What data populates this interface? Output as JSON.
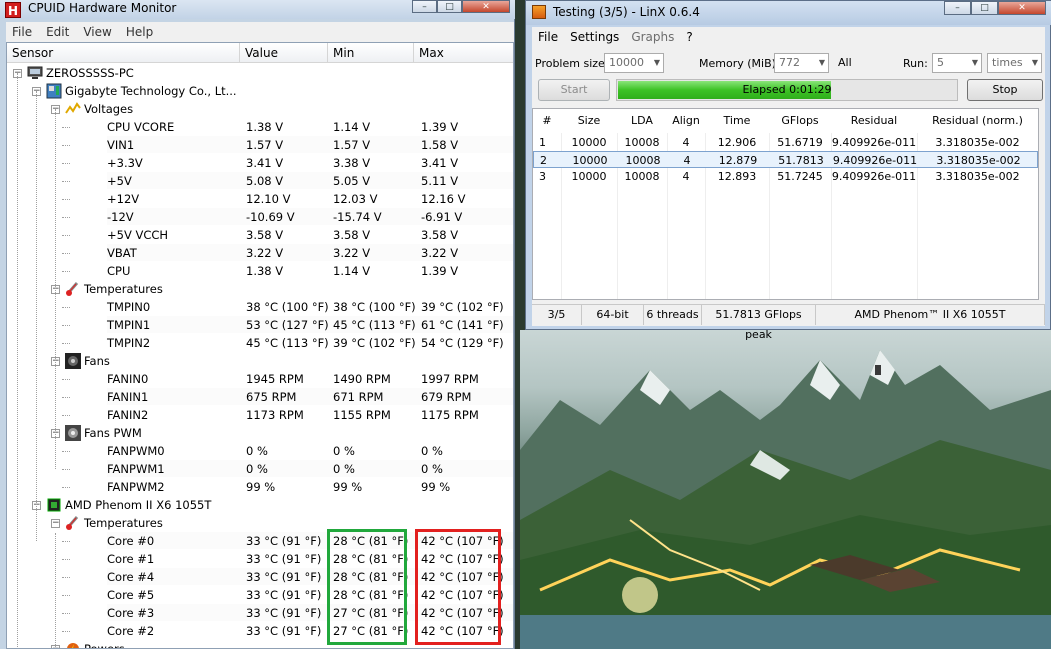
{
  "hwmonitor": {
    "title": "CPUID Hardware Monitor",
    "icon_letter": "H",
    "menu": [
      "File",
      "Edit",
      "View",
      "Help"
    ],
    "columns": [
      "Sensor",
      "Value",
      "Min",
      "Max"
    ],
    "rows": [
      {
        "level": 0,
        "kind": "node",
        "icon": "computer-icon",
        "label": "ZEROSSSSS-PC"
      },
      {
        "level": 1,
        "kind": "node",
        "icon": "motherboard-icon",
        "label": "Gigabyte Technology Co., Lt..."
      },
      {
        "level": 2,
        "kind": "node",
        "icon": "voltage-icon",
        "label": "Voltages"
      },
      {
        "level": 3,
        "kind": "leaf",
        "label": "CPU VCORE",
        "value": "1.38 V",
        "min": "1.14 V",
        "max": "1.39 V"
      },
      {
        "level": 3,
        "kind": "leaf",
        "label": "VIN1",
        "value": "1.57 V",
        "min": "1.57 V",
        "max": "1.58 V"
      },
      {
        "level": 3,
        "kind": "leaf",
        "label": "+3.3V",
        "value": "3.41 V",
        "min": "3.38 V",
        "max": "3.41 V"
      },
      {
        "level": 3,
        "kind": "leaf",
        "label": "+5V",
        "value": "5.08 V",
        "min": "5.05 V",
        "max": "5.11 V"
      },
      {
        "level": 3,
        "kind": "leaf",
        "label": "+12V",
        "value": "12.10 V",
        "min": "12.03 V",
        "max": "12.16 V"
      },
      {
        "level": 3,
        "kind": "leaf",
        "label": "-12V",
        "value": "-10.69 V",
        "min": "-15.74 V",
        "max": "-6.91 V"
      },
      {
        "level": 3,
        "kind": "leaf",
        "label": "+5V VCCH",
        "value": "3.58 V",
        "min": "3.58 V",
        "max": "3.58 V"
      },
      {
        "level": 3,
        "kind": "leaf",
        "label": "VBAT",
        "value": "3.22 V",
        "min": "3.22 V",
        "max": "3.22 V"
      },
      {
        "level": 3,
        "kind": "leaf",
        "label": "CPU",
        "value": "1.38 V",
        "min": "1.14 V",
        "max": "1.39 V"
      },
      {
        "level": 2,
        "kind": "node",
        "icon": "thermometer-icon",
        "label": "Temperatures"
      },
      {
        "level": 3,
        "kind": "leaf",
        "label": "TMPIN0",
        "value": "38 °C  (100 °F)",
        "min": "38 °C  (100 °F)",
        "max": "39 °C  (102 °F)"
      },
      {
        "level": 3,
        "kind": "leaf",
        "label": "TMPIN1",
        "value": "53 °C  (127 °F)",
        "min": "45 °C  (113 °F)",
        "max": "61 °C  (141 °F)"
      },
      {
        "level": 3,
        "kind": "leaf",
        "label": "TMPIN2",
        "value": "45 °C  (113 °F)",
        "min": "39 °C  (102 °F)",
        "max": "54 °C  (129 °F)"
      },
      {
        "level": 2,
        "kind": "node",
        "icon": "fan-icon",
        "label": "Fans"
      },
      {
        "level": 3,
        "kind": "leaf",
        "label": "FANIN0",
        "value": "1945 RPM",
        "min": "1490 RPM",
        "max": "1997 RPM"
      },
      {
        "level": 3,
        "kind": "leaf",
        "label": "FANIN1",
        "value": "675 RPM",
        "min": "671 RPM",
        "max": "679 RPM"
      },
      {
        "level": 3,
        "kind": "leaf",
        "label": "FANIN2",
        "value": "1173 RPM",
        "min": "1155 RPM",
        "max": "1175 RPM"
      },
      {
        "level": 2,
        "kind": "node",
        "icon": "fan-pwm-icon",
        "label": "Fans PWM"
      },
      {
        "level": 3,
        "kind": "leaf",
        "label": "FANPWM0",
        "value": "0 %",
        "min": "0 %",
        "max": "0 %"
      },
      {
        "level": 3,
        "kind": "leaf",
        "label": "FANPWM1",
        "value": "0 %",
        "min": "0 %",
        "max": "0 %"
      },
      {
        "level": 3,
        "kind": "leaf",
        "label": "FANPWM2",
        "value": "99 %",
        "min": "99 %",
        "max": "99 %"
      },
      {
        "level": 1,
        "kind": "node",
        "icon": "cpu-chip-icon",
        "label": "AMD Phenom II X6 1055T"
      },
      {
        "level": 2,
        "kind": "node",
        "icon": "thermometer-icon",
        "label": "Temperatures"
      },
      {
        "level": 3,
        "kind": "leaf",
        "label": "Core #0",
        "value": "33 °C  (91 °F)",
        "min": "28 °C  (81 °F)",
        "max": "42 °C  (107 °F)"
      },
      {
        "level": 3,
        "kind": "leaf",
        "label": "Core #1",
        "value": "33 °C  (91 °F)",
        "min": "28 °C  (81 °F)",
        "max": "42 °C  (107 °F)"
      },
      {
        "level": 3,
        "kind": "leaf",
        "label": "Core #4",
        "value": "33 °C  (91 °F)",
        "min": "28 °C  (81 °F)",
        "max": "42 °C  (107 °F)"
      },
      {
        "level": 3,
        "kind": "leaf",
        "label": "Core #5",
        "value": "33 °C  (91 °F)",
        "min": "28 °C  (81 °F)",
        "max": "42 °C  (107 °F)"
      },
      {
        "level": 3,
        "kind": "leaf",
        "label": "Core #3",
        "value": "33 °C  (91 °F)",
        "min": "27 °C  (81 °F)",
        "max": "42 °C  (107 °F)"
      },
      {
        "level": 3,
        "kind": "leaf",
        "label": "Core #2",
        "value": "33 °C  (91 °F)",
        "min": "27 °C  (81 °F)",
        "max": "42 °C  (107 °F)"
      },
      {
        "level": 2,
        "kind": "node",
        "icon": "power-icon",
        "label": "Powers"
      }
    ],
    "highlight_colors": {
      "min": "#21a83c",
      "max": "#e2201f"
    }
  },
  "linx": {
    "title": "Testing (3/5) - LinX 0.6.4",
    "menu": [
      {
        "label": "File",
        "enabled": true
      },
      {
        "label": "Settings",
        "enabled": true
      },
      {
        "label": "Graphs",
        "enabled": false
      },
      {
        "label": "?",
        "enabled": true
      }
    ],
    "problem_size": {
      "label": "Problem size:",
      "value": "10000"
    },
    "memory": {
      "label": "Memory (MiB):",
      "value": "772",
      "all": "All"
    },
    "run": {
      "label": "Run:",
      "value": "5",
      "unit": "times"
    },
    "start_label": "Start",
    "stop_label": "Stop",
    "progress": {
      "text": "Elapsed 0:01:29",
      "fraction": 0.63,
      "color": "#3dc226"
    },
    "columns": [
      "#",
      "Size",
      "LDA",
      "Align",
      "Time",
      "GFlops",
      "Residual",
      "Residual (norm.)"
    ],
    "results": [
      [
        "1",
        "10000",
        "10008",
        "4",
        "12.906",
        "51.6719",
        "9.409926e-011",
        "3.318035e-002"
      ],
      [
        "2",
        "10000",
        "10008",
        "4",
        "12.879",
        "51.7813",
        "9.409926e-011",
        "3.318035e-002"
      ],
      [
        "3",
        "10000",
        "10008",
        "4",
        "12.893",
        "51.7245",
        "9.409926e-011",
        "3.318035e-002"
      ]
    ],
    "selected_row": 1,
    "status": [
      "3/5",
      "64-bit",
      "6 threads",
      "51.7813 GFlops peak",
      "AMD Phenom™ II X6 1055T"
    ]
  }
}
